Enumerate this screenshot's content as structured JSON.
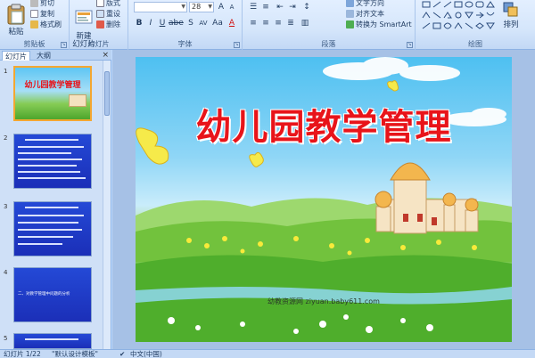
{
  "ribbon": {
    "clipboard": {
      "paste": "粘贴",
      "cut": "剪切",
      "copy": "复制",
      "format_painter": "格式刷",
      "label": "剪贴板"
    },
    "slides": {
      "new_slide": "新建\n幻灯片",
      "layout": "版式",
      "reset": "重设",
      "delete": "删除",
      "label": "幻灯片"
    },
    "font": {
      "font_name": "",
      "font_size": "28",
      "label": "字体"
    },
    "paragraph": {
      "text_direction": "文字方向",
      "align_text": "对齐文本",
      "smartart": "转换为 SmartArt",
      "label": "段落"
    },
    "drawing": {
      "arrange": "排列",
      "label": "绘图"
    }
  },
  "left_pane": {
    "tab_slides": "幻灯片",
    "tab_outline": "大纲",
    "close": "×",
    "thumbnails": [
      {
        "number": "1",
        "title": "幼儿园教学管理"
      },
      {
        "number": "2",
        "lines": 7
      },
      {
        "number": "3",
        "lines": 6
      },
      {
        "number": "4",
        "lines": 1,
        "text": "二、对教学管理中问题的分析"
      },
      {
        "number": "5",
        "lines": 1
      }
    ]
  },
  "slide": {
    "title": "幼儿园教学管理",
    "watermark": "幼教资源网 ziyuan.baby611.com"
  },
  "status_bar": {
    "slide_count": "幻灯片 1/22",
    "theme": "\"默认设计模板\"",
    "language": "中文(中国)"
  },
  "colors": {
    "title_red": "#e8141a",
    "selected_border": "#f4a731",
    "thumb_blue": "#2449d6"
  }
}
